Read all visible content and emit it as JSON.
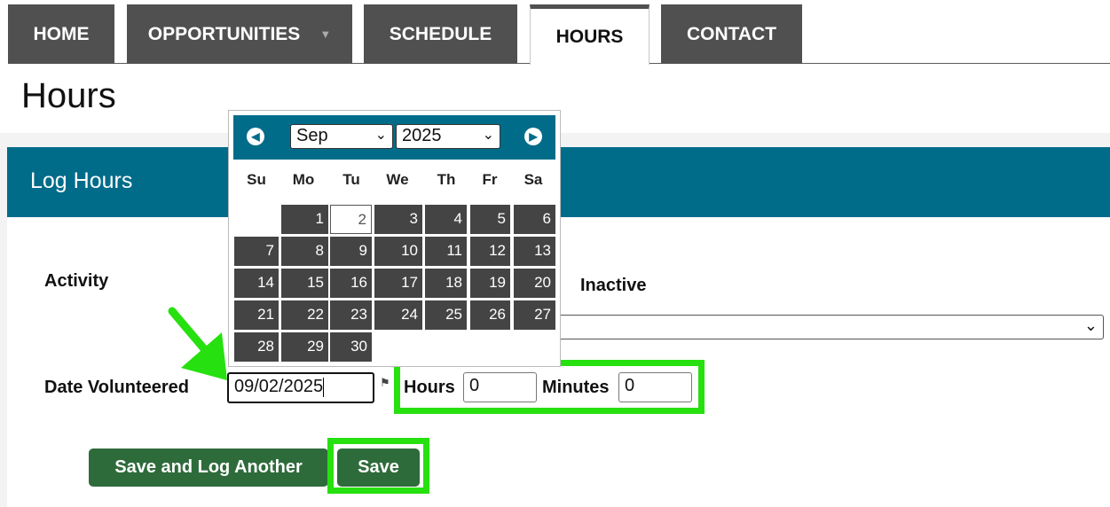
{
  "nav": {
    "tabs": [
      {
        "label": "HOME"
      },
      {
        "label": "OPPORTUNITIES"
      },
      {
        "label": "SCHEDULE"
      },
      {
        "label": "HOURS"
      },
      {
        "label": "CONTACT"
      }
    ]
  },
  "page": {
    "title": "Hours"
  },
  "panel": {
    "title": "Log Hours"
  },
  "form": {
    "activity_label": "Activity",
    "status_label": "Inactive",
    "activity_value": "",
    "date_label": "Date Volunteered",
    "date_value": "09/02/2025",
    "hours_label": "Hours",
    "hours_value": "0",
    "minutes_label": "Minutes",
    "minutes_value": "0"
  },
  "buttons": {
    "save_another": "Save and Log Another",
    "save": "Save"
  },
  "datepicker": {
    "month": "Sep",
    "year": "2025",
    "weekdays": [
      "Su",
      "Mo",
      "Tu",
      "We",
      "Th",
      "Fr",
      "Sa"
    ],
    "week1": [
      "1",
      "2",
      "3",
      "4",
      "5",
      "6"
    ],
    "week2": [
      "7",
      "8",
      "9",
      "10",
      "11",
      "12",
      "13"
    ],
    "week3": [
      "14",
      "15",
      "16",
      "17",
      "18",
      "19",
      "20"
    ],
    "week4": [
      "21",
      "22",
      "23",
      "24",
      "25",
      "26",
      "27"
    ],
    "week5": [
      "28",
      "29",
      "30"
    ]
  },
  "colors": {
    "nav_tab": "#505050",
    "header": "#006c8a",
    "button": "#2e6b3b",
    "highlight": "#27e00f",
    "calendar_day": "#444444"
  },
  "icons": [
    "chevron-left-icon",
    "chevron-right-icon",
    "dropdown-caret-icon",
    "flag-icon",
    "arrow-pointer-icon"
  ]
}
